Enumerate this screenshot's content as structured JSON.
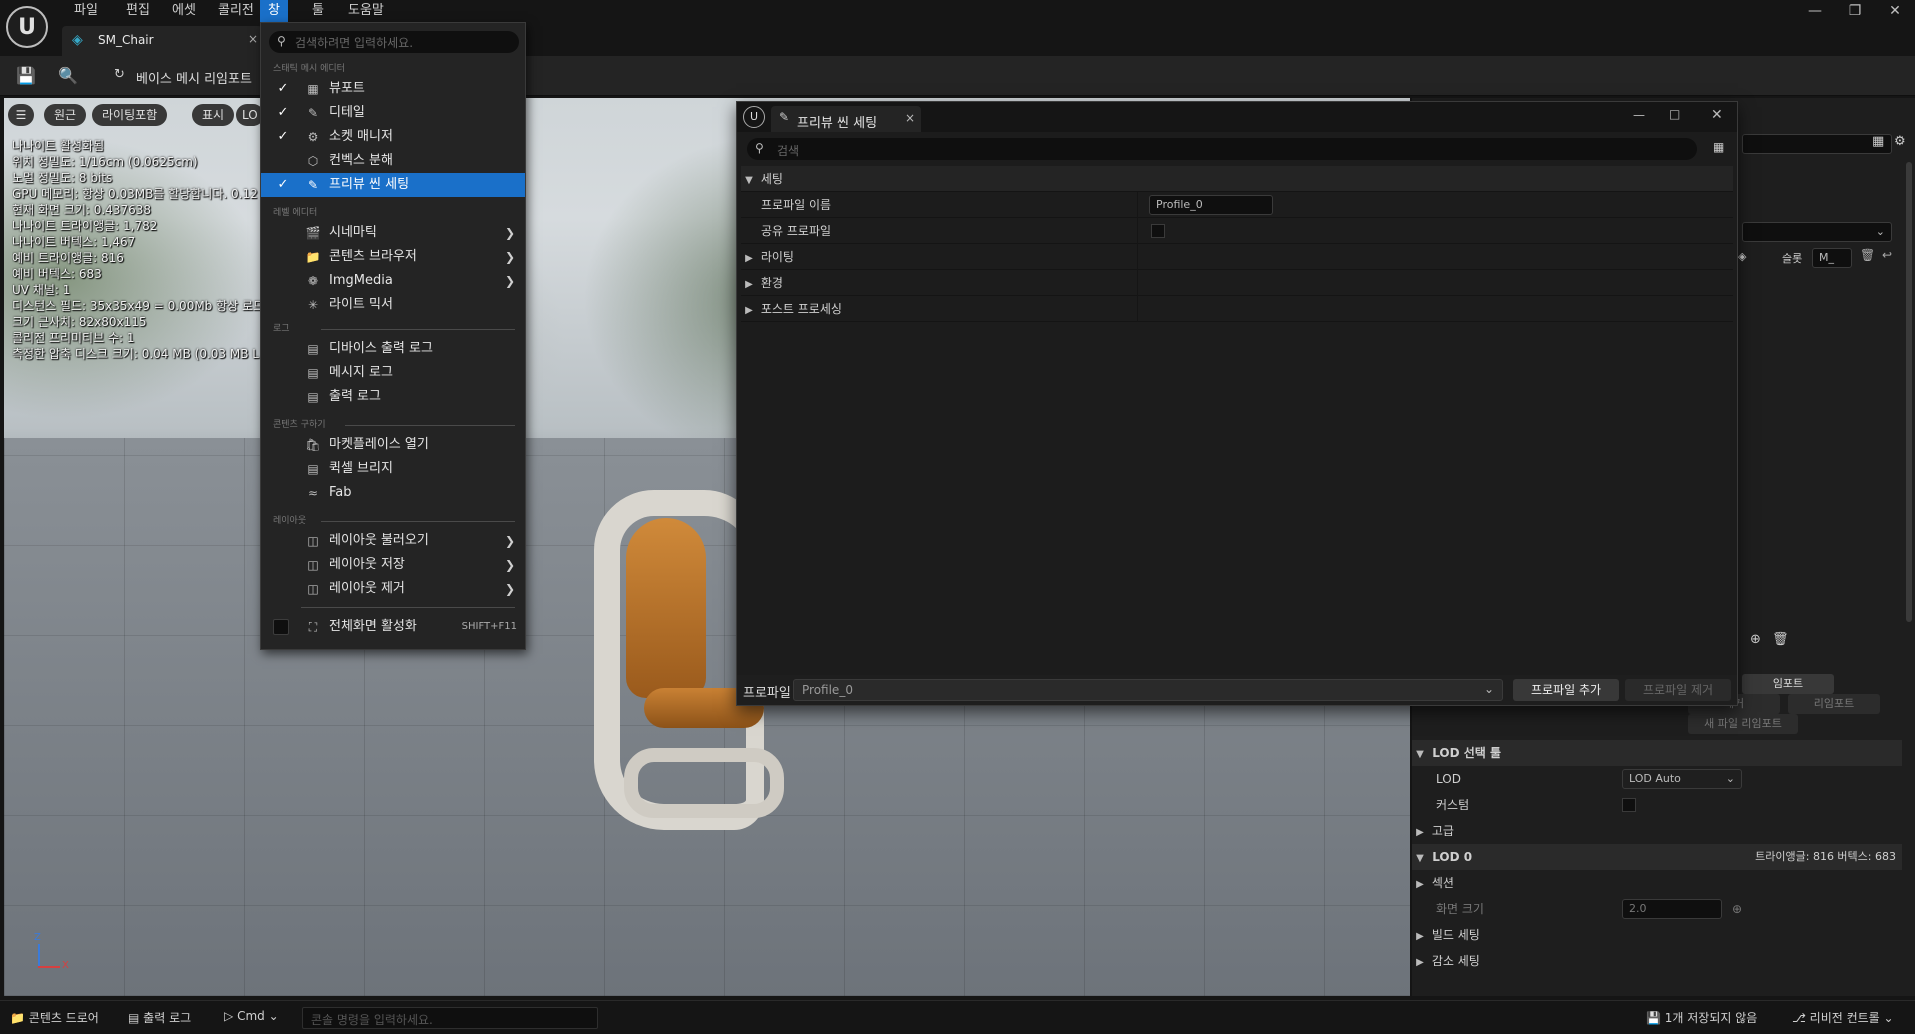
{
  "menubar": {
    "items": [
      "파일",
      "편집",
      "에셋",
      "콜리전",
      "창",
      "툴",
      "도움말"
    ],
    "active_index": 4,
    "window_controls": [
      "minimize-icon",
      "restore-icon",
      "close-icon"
    ]
  },
  "tab": {
    "asset_name": "SM_Chair"
  },
  "toolbar": {
    "reimport_label": "베이스 메시 리임포트"
  },
  "viewport": {
    "pills": [
      "원근",
      "라이팅포함",
      "표시",
      "LO"
    ],
    "stats": [
      "나나이트 활성화됨",
      "위치 정밀도: 1/16cm (0.0625cm)",
      "노멀 정밀도: 8 bits",
      "GPU 메모리: 항상 0.03MB를 할당합니다. 0.12",
      "현재 화면 크기: 0.437638",
      "나나이트 트라이앵글: 1,782",
      "나나이트 버텍스: 1,467",
      "예비 트라이앵글: 816",
      "예비 버텍스: 683",
      "UV 채널: 1",
      "디스턴스 필드: 35x35x49 = 0.00Mb 항상 로드",
      "크기 근사치: 82x80x115",
      "콜리전 프리미티브 수: 1",
      "측정한 압축 디스크 크기: 0.04 MB (0.03 MB L"
    ],
    "axis": {
      "z": "Z",
      "x": "X"
    }
  },
  "window_menu": {
    "search_placeholder": "검색하려면 입력하세요.",
    "sections": [
      {
        "category": "스태틱 메시 에디터",
        "items": [
          {
            "label": "뷰포트",
            "icon": "viewport-icon",
            "checked": true
          },
          {
            "label": "디테일",
            "icon": "details-icon",
            "checked": true
          },
          {
            "label": "소켓 매니저",
            "icon": "socket-icon",
            "checked": true
          },
          {
            "label": "컨벡스 분해",
            "icon": "convex-icon",
            "checked": false
          },
          {
            "label": "프리뷰 씬 세팅",
            "icon": "preview-scene-icon",
            "checked": true,
            "highlighted": true
          }
        ]
      },
      {
        "category": "레벨 에디터",
        "items": [
          {
            "label": "시네마틱",
            "icon": "cinematic-icon",
            "submenu": true
          },
          {
            "label": "콘텐츠 브라우저",
            "icon": "content-browser-icon",
            "submenu": true
          },
          {
            "label": "ImgMedia",
            "icon": "imgmedia-icon",
            "submenu": true
          },
          {
            "label": "라이트 믹서",
            "icon": "light-mixer-icon",
            "submenu": false
          }
        ]
      },
      {
        "category": "로그",
        "items": [
          {
            "label": "디바이스 출력 로그",
            "icon": "log-icon"
          },
          {
            "label": "메시지 로그",
            "icon": "message-log-icon"
          },
          {
            "label": "출력 로그",
            "icon": "output-log-icon"
          }
        ]
      },
      {
        "category": "콘텐츠 구하기",
        "items": [
          {
            "label": "마켓플레이스 열기",
            "icon": "marketplace-icon"
          },
          {
            "label": "퀵셀 브리지",
            "icon": "quixel-icon"
          },
          {
            "label": "Fab",
            "icon": "fab-icon"
          }
        ]
      },
      {
        "category": "레이아웃",
        "items": [
          {
            "label": "레이아웃 불러오기",
            "icon": "layout-load-icon",
            "submenu": true
          },
          {
            "label": "레이아웃 저장",
            "icon": "layout-save-icon",
            "submenu": true
          },
          {
            "label": "레이아웃 제거",
            "icon": "layout-remove-icon",
            "submenu": true
          }
        ]
      }
    ],
    "fullscreen": {
      "label": "전체화면 활성화",
      "shortcut": "SHIFT+F11"
    }
  },
  "preview_scene_window": {
    "tab_title": "프리뷰 씬 세팅",
    "search_placeholder": "검색",
    "rows": [
      {
        "label": "세팅",
        "type": "section",
        "expanded": true
      },
      {
        "label": "프로파일 이름",
        "type": "field",
        "value": "Profile_0"
      },
      {
        "label": "공유 프로파일",
        "type": "checkbox",
        "checked": false
      },
      {
        "label": "라이팅",
        "type": "group"
      },
      {
        "label": "환경",
        "type": "group"
      },
      {
        "label": "포스트 프로세싱",
        "type": "group"
      }
    ],
    "footer": {
      "label": "프로파일",
      "selected_profile": "Profile_0",
      "add_button": "프로파일 추가",
      "remove_button": "프로파일 제거"
    }
  },
  "details": {
    "header_text": "슬롯",
    "slot_value": "M_",
    "import_buttons": {
      "import": "임포트",
      "remove": "제거",
      "reimport": "리임포트",
      "new_file_reimport": "새 파일 리임포트"
    },
    "lod_picker": {
      "section": "LOD 선택 툴",
      "lod_label": "LOD",
      "lod_value": "LOD Auto",
      "custom_label": "커스텀",
      "advanced_label": "고급"
    },
    "lod0": {
      "section": "LOD 0",
      "stats": "트라이앵글: 816   버텍스: 683",
      "sections_label": "섹션",
      "screen_size_label": "화면 크기",
      "screen_size_value": "2.0",
      "build_settings": "빌드 세팅",
      "reduction_settings": "감소 세팅"
    }
  },
  "statusbar": {
    "content_drawer": "콘텐츠 드로어",
    "output_log": "출력 로그",
    "cmd": "Cmd",
    "console_placeholder": "콘솔 명령을 입력하세요.",
    "unsaved": "1개 저장되지 않음",
    "revision_control": "리비전 컨트롤"
  }
}
